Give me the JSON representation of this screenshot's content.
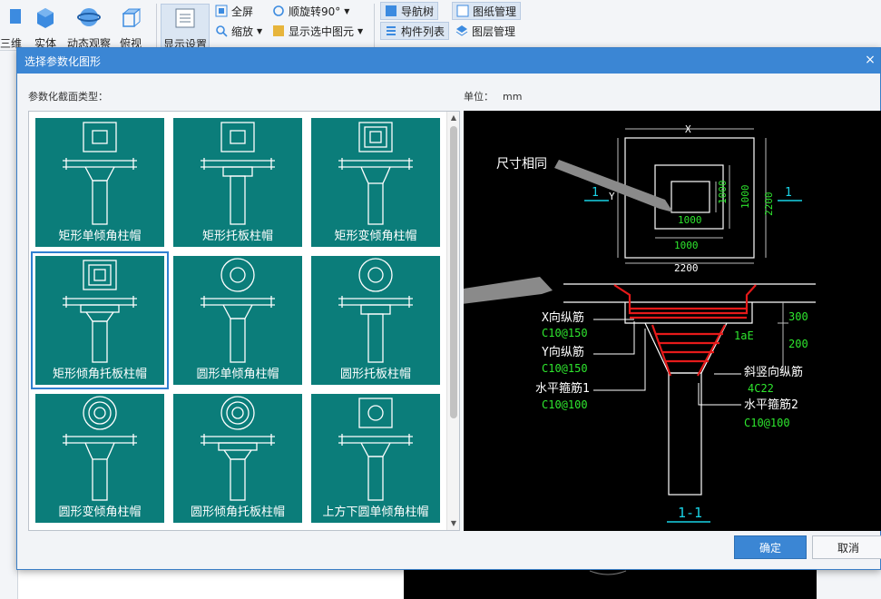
{
  "ribbon": {
    "view3d": "/三维",
    "solid": "实体",
    "orbit": "动态观察",
    "top_view": "俯视",
    "display_settings": "显示设置",
    "fullscreen": "全屏",
    "zoom": "缩放",
    "rotate": "顺旋转90°",
    "show_selected": "显示选中图元",
    "nav_tree": "导航树",
    "component_list": "构件列表",
    "drawing_mgmt": "图纸管理",
    "layer_mgmt": "图层管理"
  },
  "dialog": {
    "title": "选择参数化图形",
    "close": "×",
    "section_type_label": "参数化截面类型：",
    "unit_label": "单位：",
    "unit_value": "mm",
    "ok": "确定",
    "cancel": "取消"
  },
  "tiles": [
    {
      "label": "矩形单倾角柱帽",
      "selected": false
    },
    {
      "label": "矩形托板柱帽",
      "selected": false
    },
    {
      "label": "矩形变倾角柱帽",
      "selected": false
    },
    {
      "label": "矩形倾角托板柱帽",
      "selected": true
    },
    {
      "label": "圆形单倾角柱帽",
      "selected": false
    },
    {
      "label": "圆形托板柱帽",
      "selected": false
    },
    {
      "label": "圆形变倾角柱帽",
      "selected": false
    },
    {
      "label": "圆形倾角托板柱帽",
      "selected": false
    },
    {
      "label": "上方下圆单倾角柱帽",
      "selected": false
    }
  ],
  "preview": {
    "annotation": "尺寸相同",
    "dim_x": "X",
    "dim_y": "Y",
    "dim_inner_w": "1000",
    "dim_inner_h": "1000",
    "dim_mid_w": "1000",
    "dim_mid_h": "1000",
    "dim_outer_h": "2200",
    "dim_outer_w": "2200",
    "section_mark": "1",
    "x_bar_label": "X向纵筋",
    "x_bar_spec": "C10@150",
    "y_bar_label": "Y向纵筋",
    "y_bar_spec": "C10@150",
    "h_stirrup1_label": "水平箍筋1",
    "h_stirrup1_spec": "C10@100",
    "slant_bar_label": "斜竖向纵筋",
    "slant_bar_spec": "4C22",
    "h_stirrup2_label": "水平箍筋2",
    "h_stirrup2_spec": "C10@100",
    "dim_300": "300",
    "dim_200": "200",
    "lae": "1aE",
    "section_title": "1-1"
  },
  "colors": {
    "tile_bg": "#0b7d7a",
    "accent": "#3b86d4",
    "dim_green": "#2ee62e",
    "cyan": "#19d3e6",
    "rebar_red": "#e51a1a"
  }
}
